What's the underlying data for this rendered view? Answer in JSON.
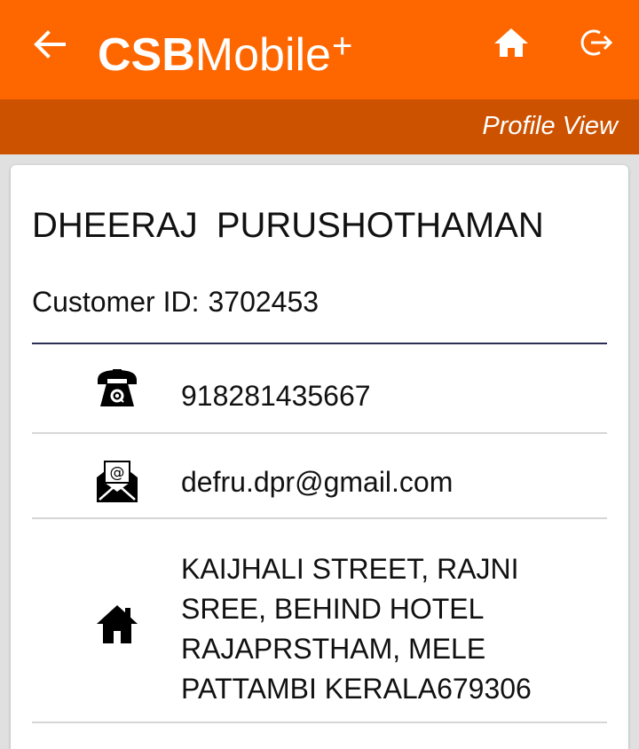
{
  "header": {
    "brand_bold": "CSB",
    "brand_light": "Mobile",
    "brand_plus": "+",
    "back_icon": "arrow-left-icon",
    "home_icon": "home-icon",
    "logout_icon": "logout-icon",
    "accent_color": "#fe6700"
  },
  "subheader": {
    "title": "Profile View",
    "color": "#cc5200"
  },
  "profile": {
    "name": "DHEERAJ  PURUSHOTHAMAN",
    "customer_id_label": "Customer ID:",
    "customer_id": "3702453",
    "phone": "918281435667",
    "phone_icon": "telephone-icon",
    "email": "defru.dpr@gmail.com",
    "email_icon": "email-icon",
    "address": "KAIJHALI STREET, RAJNI\nSREE, BEHIND HOTEL\nRAJAPRSTHAM, MELE\nPATTAMBI  KERALA679306",
    "address_icon": "home-icon"
  }
}
